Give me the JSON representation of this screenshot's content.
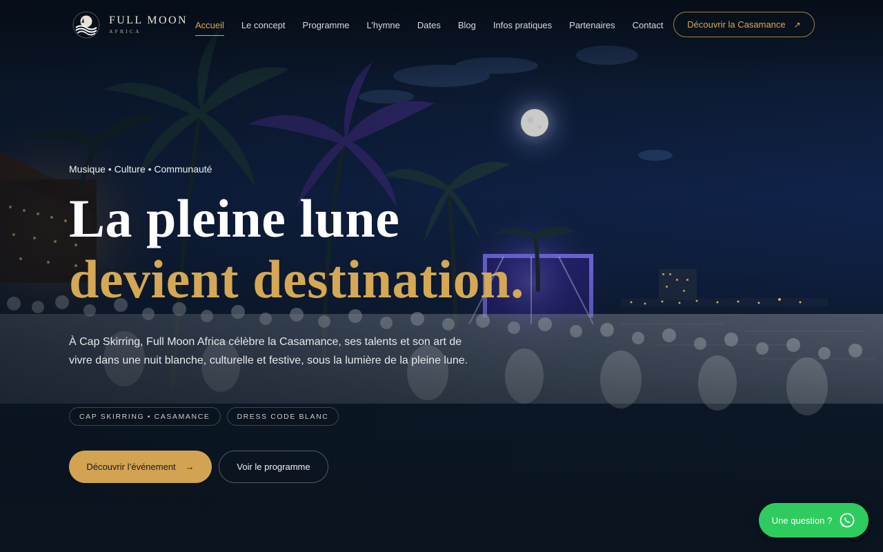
{
  "brand": {
    "title": "FULL MOON",
    "subtitle": "AFRICA"
  },
  "nav": {
    "items": [
      {
        "label": "Accueil",
        "active": true
      },
      {
        "label": "Le concept",
        "active": false
      },
      {
        "label": "Programme",
        "active": false
      },
      {
        "label": "L’hymne",
        "active": false
      },
      {
        "label": "Dates",
        "active": false
      },
      {
        "label": "Blog",
        "active": false
      },
      {
        "label": "Infos pratiques",
        "active": false
      },
      {
        "label": "Partenaires",
        "active": false
      },
      {
        "label": "Contact",
        "active": false
      }
    ],
    "cta_label": "Découvrir la Casamance",
    "cta_icon": "arrow-up-right-icon"
  },
  "hero": {
    "eyebrow": "Musique • Culture • Communauté",
    "title_line1": "La pleine lune",
    "title_line2": "devient destination.",
    "lead": "À Cap Skirring, Full Moon Africa célèbre la Casamance, ses talents et son art de vivre dans une nuit blanche, culturelle et festive, sous la lumière de la pleine lune.",
    "chips": [
      "CAP SKIRRING • CASAMANCE",
      "DRESS CODE BLANC"
    ],
    "primary_button": "Découvrir l’événement",
    "primary_icon": "arrow-right-icon",
    "secondary_button": "Voir le programme"
  },
  "whatsapp": {
    "label": "Une question ?",
    "icon": "whatsapp-icon"
  },
  "colors": {
    "accent_gold": "#d2a352",
    "background": "#0b1520",
    "whatsapp_green": "#2ecc5f"
  }
}
